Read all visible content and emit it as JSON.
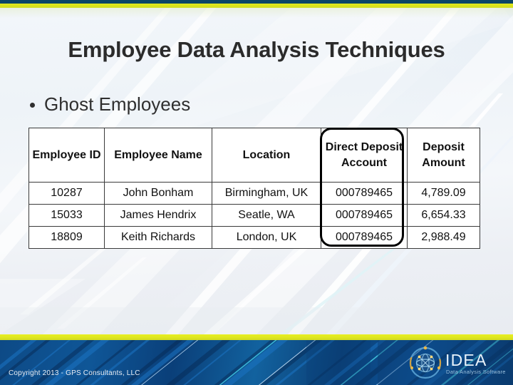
{
  "slide": {
    "title": "Employee Data Analysis Techniques",
    "bullets": [
      {
        "text": "Ghost Employees",
        "marker": "bullet-dot"
      }
    ]
  },
  "theme": {
    "top_rule_navy": "#0b4566",
    "top_rule_lime": "#d9e21a",
    "footer_lime": "#dde520",
    "footer_blue": "#0d4a86",
    "title_color": "#2b2b2b",
    "table_border": "#3a3a3a",
    "highlight_outline": "#000000"
  },
  "table": {
    "headers": [
      "Employee ID",
      "Employee Name",
      "Location",
      "Direct Deposit Account",
      "Deposit Amount"
    ],
    "rows": [
      {
        "employee_id": "10287",
        "employee_name": "John Bonham",
        "location": "Birmingham, UK",
        "direct_deposit_account": "000789465",
        "deposit_amount": "4,789.09"
      },
      {
        "employee_id": "15033",
        "employee_name": "James Hendrix",
        "location": "Seatle, WA",
        "direct_deposit_account": "000789465",
        "deposit_amount": "6,654.33"
      },
      {
        "employee_id": "18809",
        "employee_name": "Keith Richards",
        "location": "London, UK",
        "direct_deposit_account": "000789465",
        "deposit_amount": "2,988.49"
      }
    ],
    "highlighted_column": "Direct Deposit Account"
  },
  "footer": {
    "copyright": "Copyright 2013 - GPS Consultants, LLC",
    "logo": {
      "name": "IDEA",
      "tagline": "Data Analysis Software",
      "emblem": "globe-orbit-icon"
    }
  }
}
